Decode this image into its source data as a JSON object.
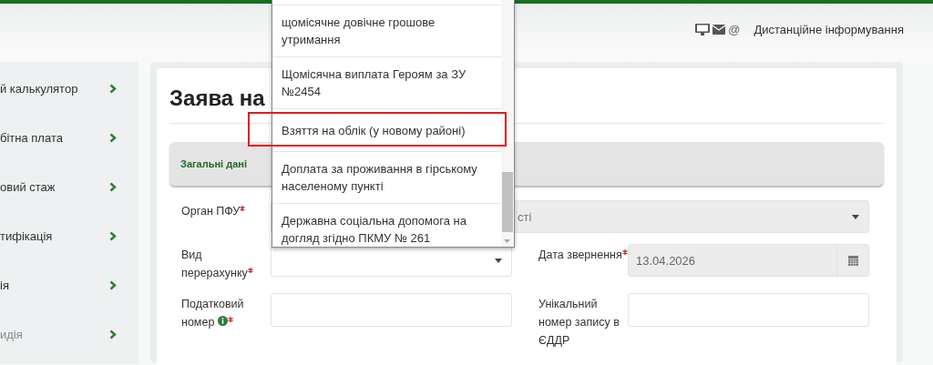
{
  "header": {
    "contact_icon_char": "@",
    "link": "Дистанційне інформування"
  },
  "sidebar": {
    "items": [
      {
        "label": "й калькулятор",
        "muted": false
      },
      {
        "label": "бітна плата",
        "muted": false
      },
      {
        "label": "овий стаж",
        "muted": false
      },
      {
        "label": "тифікація",
        "muted": false
      },
      {
        "label": "ія",
        "muted": false
      },
      {
        "label": "идія",
        "muted": true
      }
    ]
  },
  "form": {
    "title": "Заява на",
    "section": "Загальні дані",
    "fields": [
      {
        "label": "Орган ПФУ",
        "required": true,
        "info": false,
        "kind": "select",
        "value": "сті",
        "disabled": true
      },
      {
        "label": "Вид перерахунку",
        "required": true,
        "info": false,
        "kind": "select",
        "disabled": false
      },
      {
        "label": "Дата звернення",
        "required": true,
        "info": false,
        "kind": "date",
        "value": "13.04.2026",
        "disabled": true
      },
      {
        "label": "Податковий номер",
        "required": true,
        "info": true,
        "kind": "text",
        "disabled": false
      },
      {
        "label": "Унікальний номер запису в ЄДДР",
        "required": false,
        "info": false,
        "kind": "text",
        "disabled": false
      }
    ]
  },
  "dropdown": {
    "options": [
      {
        "label": "щомісячне довічне грошове утримання",
        "highlighted": false
      },
      {
        "label": "Щомісячна виплата Героям за ЗУ №2454",
        "highlighted": false
      },
      {
        "label": "Взяття на облік (у новому районі)",
        "highlighted": true
      },
      {
        "label": "Доплата за проживання в гірському населеному пункті",
        "highlighted": false
      },
      {
        "label": "Державна соціальна допомога на догляд згідно ПКМУ № 261",
        "highlighted": false
      }
    ]
  }
}
